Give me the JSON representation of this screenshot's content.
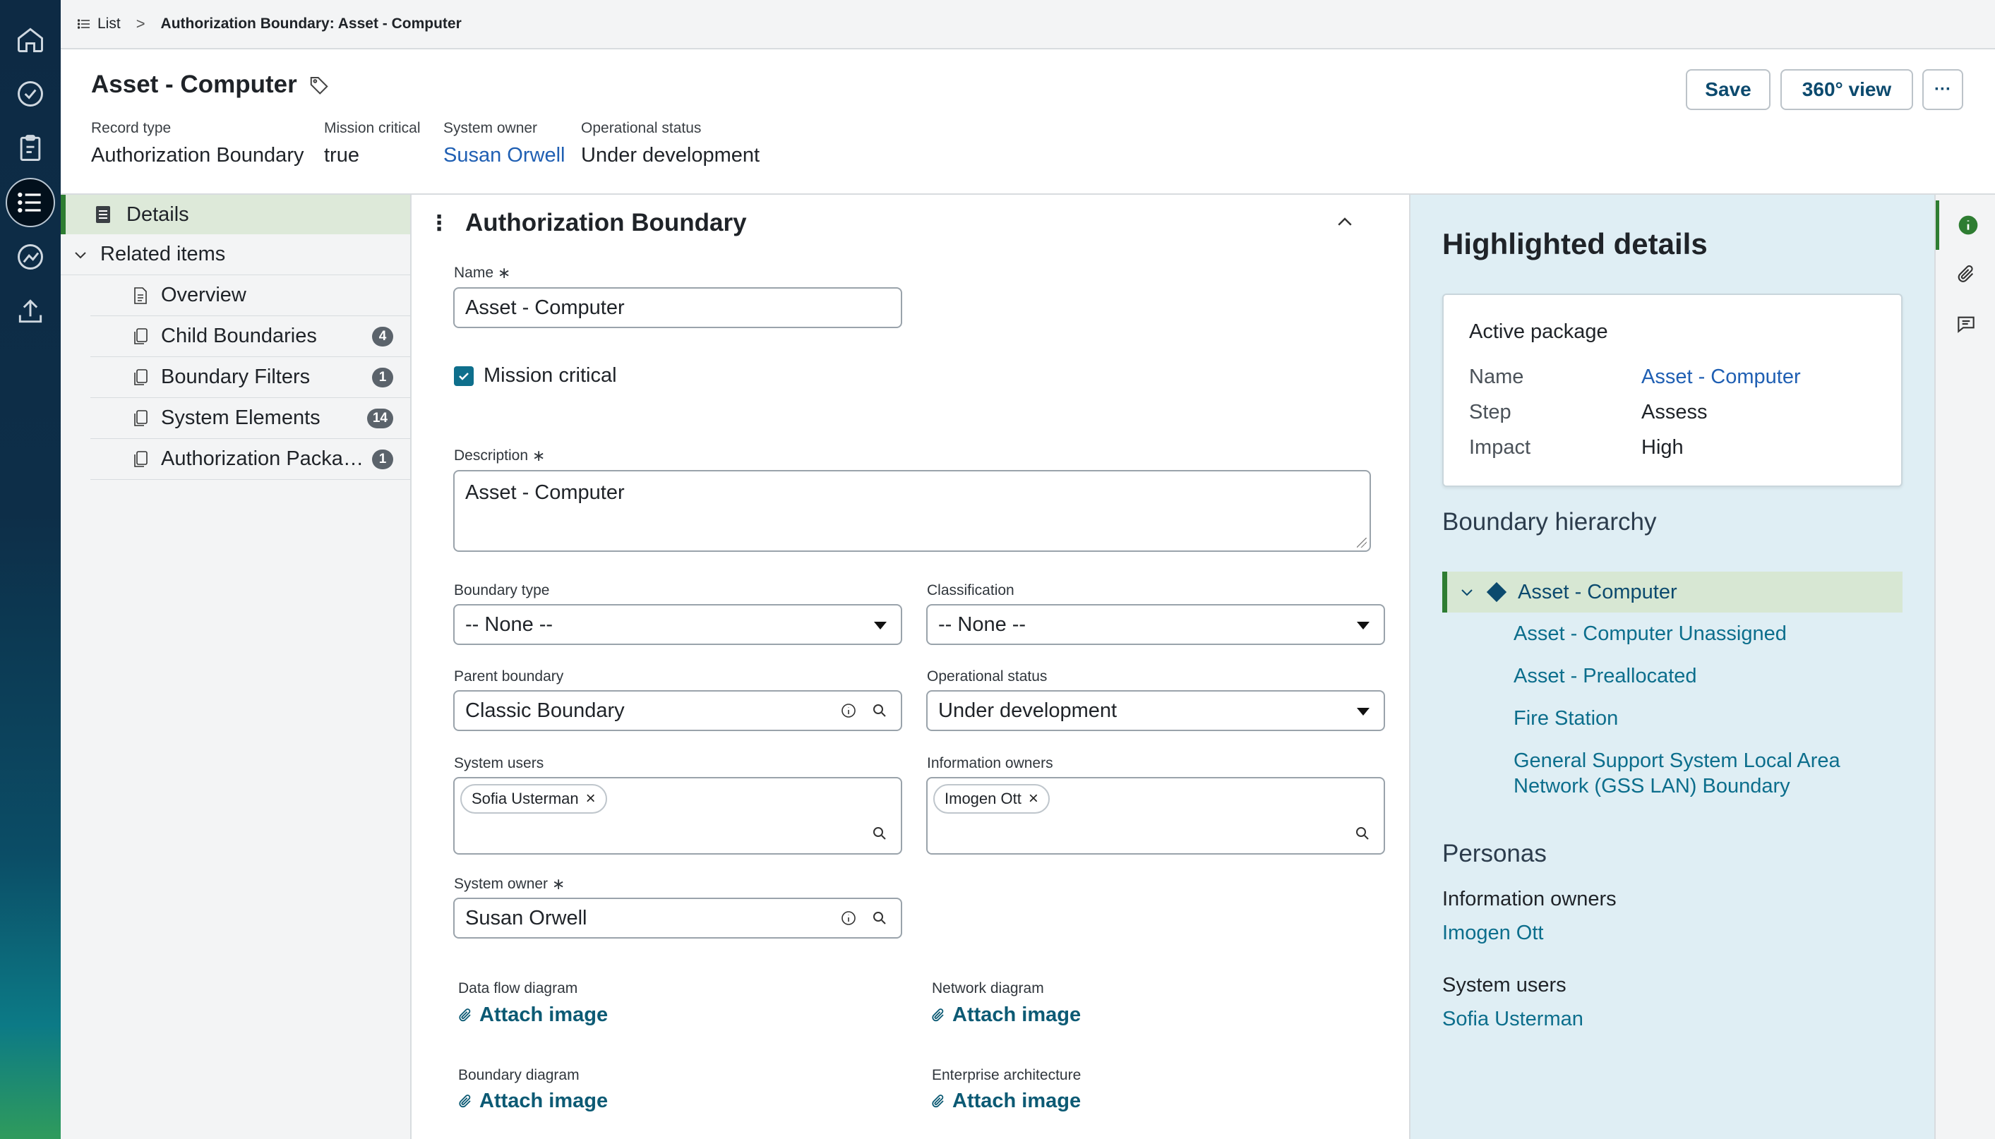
{
  "breadcrumb": {
    "list_label": "List",
    "separator": ">",
    "current": "Authorization Boundary: Asset - Computer"
  },
  "record": {
    "title": "Asset - Computer",
    "meta": [
      {
        "key": "Record type",
        "value": "Authorization Boundary"
      },
      {
        "key": "Mission critical",
        "value": "true"
      },
      {
        "key": "System owner",
        "value": "Susan Orwell"
      },
      {
        "key": "Operational status",
        "value": "Under development"
      }
    ],
    "buttons": {
      "save": "Save",
      "view360": "360° view",
      "more": "···"
    }
  },
  "leftnav": {
    "details": "Details",
    "related": "Related items",
    "items": [
      {
        "label": "Overview",
        "count": ""
      },
      {
        "label": "Child Boundaries",
        "count": "4"
      },
      {
        "label": "Boundary Filters",
        "count": "1"
      },
      {
        "label": "System Elements",
        "count": "14"
      },
      {
        "label": "Authorization Packag...",
        "count": "1"
      }
    ]
  },
  "form": {
    "section_title": "Authorization Boundary",
    "required_mark": "∗",
    "name_label": "Name",
    "name_value": "Asset - Computer",
    "mission_critical_label": "Mission critical",
    "description_label": "Description",
    "description_value": "Asset - Computer",
    "boundary_type_label": "Boundary type",
    "boundary_type_value": "-- None --",
    "classification_label": "Classification",
    "classification_value": "-- None --",
    "parent_boundary_label": "Parent boundary",
    "parent_boundary_value": "Classic Boundary",
    "operational_status_label": "Operational status",
    "operational_status_value": "Under development",
    "system_users_label": "System users",
    "system_users_chip": "Sofia Usterman",
    "information_owners_label": "Information owners",
    "information_owners_chip": "Imogen Ott",
    "system_owner_label": "System owner",
    "system_owner_value": "Susan Orwell",
    "attach_text": "Attach image",
    "data_flow_label": "Data flow diagram",
    "network_label": "Network diagram",
    "boundary_diagram_label": "Boundary diagram",
    "enterprise_label": "Enterprise architecture"
  },
  "highlight": {
    "title": "Highlighted details",
    "card": {
      "title": "Active package",
      "rows": [
        {
          "key": "Name",
          "value": "Asset - Computer"
        },
        {
          "key": "Step",
          "value": "Assess"
        },
        {
          "key": "Impact",
          "value": "High"
        }
      ]
    },
    "hierarchy_title": "Boundary hierarchy",
    "hierarchy_active": "Asset - Computer",
    "hierarchy_children": [
      "Asset - Computer Unassigned",
      "Asset - Preallocated",
      "Fire Station",
      "General Support System Local Area Network (GSS LAN) Boundary"
    ],
    "personas_title": "Personas",
    "info_owners_label": "Information owners",
    "info_owners_value": "Imogen Ott",
    "system_users_label": "System users",
    "system_users_value": "Sofia Usterman"
  },
  "colors": {
    "rail_top": "#0d2a44",
    "accent_green": "#2e7d32",
    "link_blue": "#1f5fb3",
    "teal_link": "#0c6e8c",
    "panel_bg": "#dfeef4"
  }
}
